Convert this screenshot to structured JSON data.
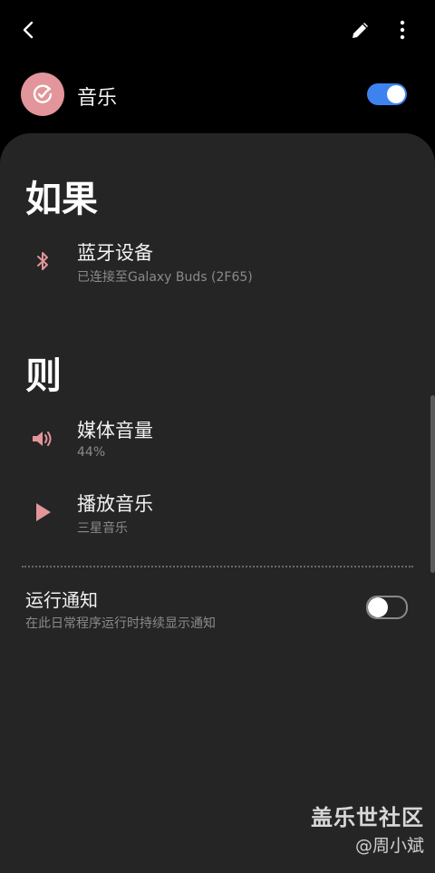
{
  "header": {
    "back_icon": "back-arrow-icon",
    "edit_icon": "pencil-icon",
    "more_icon": "more-vertical-icon"
  },
  "app": {
    "name": "音乐",
    "icon": "check-refresh-icon",
    "accent_color": "#e2959a",
    "enabled": true
  },
  "if_section": {
    "title": "如果",
    "items": [
      {
        "icon": "bluetooth-icon",
        "title": "蓝牙设备",
        "subtitle": "已连接至Galaxy Buds (2F65)"
      }
    ]
  },
  "then_section": {
    "title": "则",
    "items": [
      {
        "icon": "volume-icon",
        "title": "媒体音量",
        "subtitle": "44%"
      },
      {
        "icon": "play-icon",
        "title": "播放音乐",
        "subtitle": "三星音乐"
      }
    ]
  },
  "notification": {
    "title": "运行通知",
    "subtitle": "在此日常程序运行时持续显示通知",
    "enabled": false
  },
  "watermark": {
    "line1": "盖乐世社区",
    "line2": "@周小斌"
  },
  "colors": {
    "toggle_on": "#3e82f0",
    "card_bg": "#252525",
    "icon_pink": "#e2959a"
  }
}
